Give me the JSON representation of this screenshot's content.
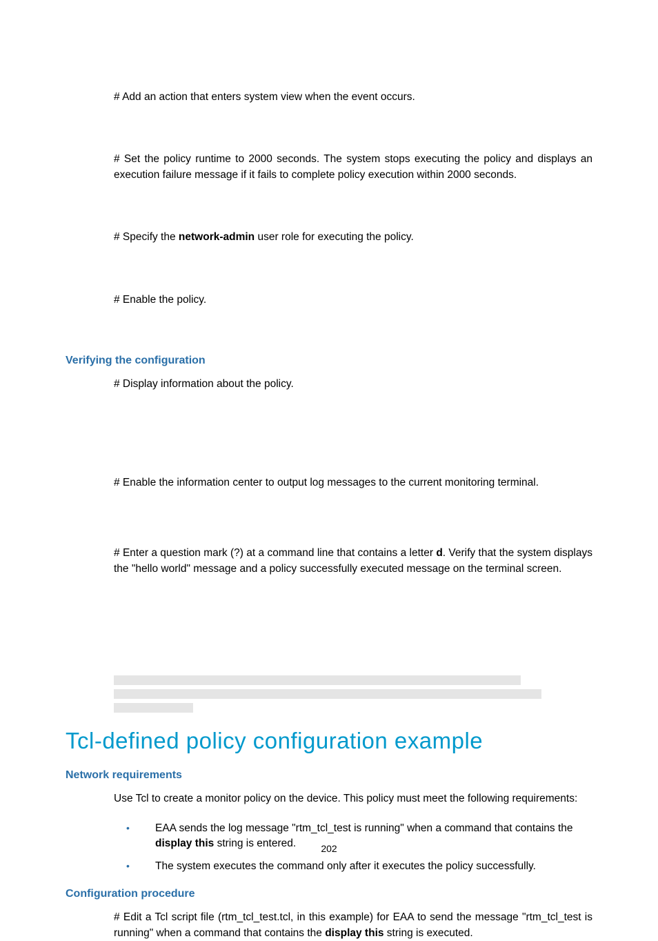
{
  "p1": "# Add an action that enters system view when the event occurs.",
  "p2a": "# Set the policy runtime to 2000 seconds. The system stops executing the policy and displays an execution failure message if it fails to complete policy execution within 2000 seconds.",
  "p3a": "# Specify the ",
  "p3b": "network-admin",
  "p3c": " user role for executing the policy.",
  "p4": "# Enable the policy.",
  "h1": "Verifying the configuration",
  "p5": "# Display information about the policy.",
  "p6": "# Enable the information center to output log messages to the current monitoring terminal.",
  "p7a": "# Enter a question mark (?) at a command line that contains a letter ",
  "p7b": "d",
  "p7c": ". Verify that the system displays the \"hello world\" message and a policy successfully executed message on the terminal screen.",
  "h2": "Tcl-defined policy configuration example",
  "h3": "Network requirements",
  "p8": "Use Tcl to create a monitor policy on the device. This policy must meet the following requirements:",
  "li1a": "EAA sends the log message \"rtm_tcl_test is running\" when a command that contains the ",
  "li1b": "display this",
  "li1c": " string is entered.",
  "li2": "The system executes the command only after it executes the policy successfully.",
  "h4": "Configuration procedure",
  "p9a": "# Edit a Tcl script file (rtm_tcl_test.tcl, in this example) for EAA to send the message \"rtm_tcl_test is running\" when a command that contains the ",
  "p9b": "display this",
  "p9c": " string is executed.",
  "page": "202"
}
